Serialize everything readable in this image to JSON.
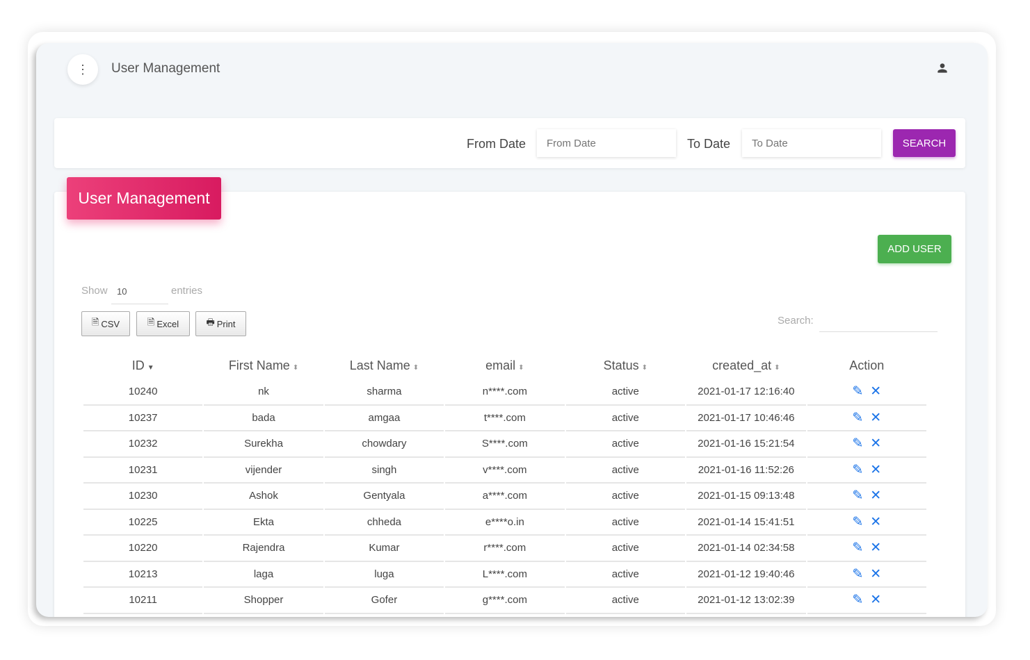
{
  "header": {
    "title": "User Management",
    "menu_icon": "more-vert-icon",
    "user_icon": "person-icon"
  },
  "filter": {
    "from_label": "From Date",
    "from_placeholder": "From Date",
    "to_label": "To Date",
    "to_placeholder": "To Date",
    "search_button": "SEARCH"
  },
  "card": {
    "title": "User Management",
    "add_user": "ADD USER",
    "show_label": "Show",
    "show_value": "10",
    "entries_label": "entries",
    "csv": "CSV",
    "excel": "Excel",
    "print": "Print",
    "search_label": "Search:"
  },
  "colors": {
    "accent_pink": "#e91e63",
    "search_purple": "#9c27b0",
    "add_green": "#4caf50",
    "action_blue": "#1a73e8"
  },
  "table": {
    "columns": [
      "ID",
      "First Name",
      "Last Name",
      "email",
      "Status",
      "created_at",
      "Action"
    ],
    "sort_column": "ID",
    "sort_direction": "descending",
    "rows": [
      [
        "10240",
        "nk",
        "sharma",
        "n****.com",
        "active",
        "2021-01-17 12:16:40"
      ],
      [
        "10237",
        "bada",
        "amgaa",
        "t****.com",
        "active",
        "2021-01-17 10:46:46"
      ],
      [
        "10232",
        "Surekha",
        "chowdary",
        "S****.com",
        "active",
        "2021-01-16 15:21:54"
      ],
      [
        "10231",
        "vijender",
        "singh",
        "v****.com",
        "active",
        "2021-01-16 11:52:26"
      ],
      [
        "10230",
        "Ashok",
        "Gentyala",
        "a****.com",
        "active",
        "2021-01-15 09:13:48"
      ],
      [
        "10225",
        "Ekta",
        "chheda",
        "e****o.in",
        "active",
        "2021-01-14 15:41:51"
      ],
      [
        "10220",
        "Rajendra",
        "Kumar",
        "r****.com",
        "active",
        "2021-01-14 02:34:58"
      ],
      [
        "10213",
        "laga",
        "luga",
        "L****.com",
        "active",
        "2021-01-12 19:40:46"
      ],
      [
        "10211",
        "Shopper",
        "Gofer",
        "g****.com",
        "active",
        "2021-01-12 13:02:39"
      ]
    ]
  }
}
